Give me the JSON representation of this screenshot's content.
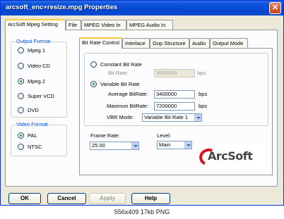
{
  "window": {
    "title": "arcsoft_enc+resize.mpg Properties",
    "close_glyph": "✕"
  },
  "tabs": [
    "ArcSoft Mpeg Setting",
    "File",
    "MPEG Video In",
    "MPEG Audio In"
  ],
  "output_format": {
    "label": "Output Format",
    "options": [
      "Mpeg 1",
      "Video CD",
      "Mpeg 2",
      "Super VCD",
      "DVD"
    ],
    "selected": "Mpeg 2"
  },
  "video_format": {
    "label": "Video Format",
    "options": [
      "PAL",
      "NTSC"
    ],
    "selected": "PAL"
  },
  "sub_tabs": [
    "Bit Rate Control",
    "Interlace",
    "Gop Structure",
    "Audio",
    "Output Mode"
  ],
  "bit_rate": {
    "constant_label": "Constant Bit Rate",
    "bit_rate_label": "Bit Rate:",
    "bit_rate_value": "3600000",
    "bit_rate_unit": "bps",
    "variable_label": "Variable Bit Rate",
    "average_label": "Average BitRate:",
    "average_value": "3400000",
    "average_unit": "bps",
    "max_label": "Maximun BitRate:",
    "max_value": "7200000",
    "max_unit": "bps",
    "vbr_mode_label": "VBR Mode:",
    "vbr_mode_value": "Variable Bit Rate 1",
    "selected": "variable"
  },
  "frame_rate": {
    "label": "Frame Rate:",
    "value": "25.00"
  },
  "level": {
    "label": "Level:",
    "value": "Main"
  },
  "logo_text": "ArcSoft",
  "buttons": {
    "ok": "OK",
    "cancel": "Cancel",
    "apply": "Apply",
    "help": "Help"
  },
  "caption": "556x409 17kb PNG"
}
